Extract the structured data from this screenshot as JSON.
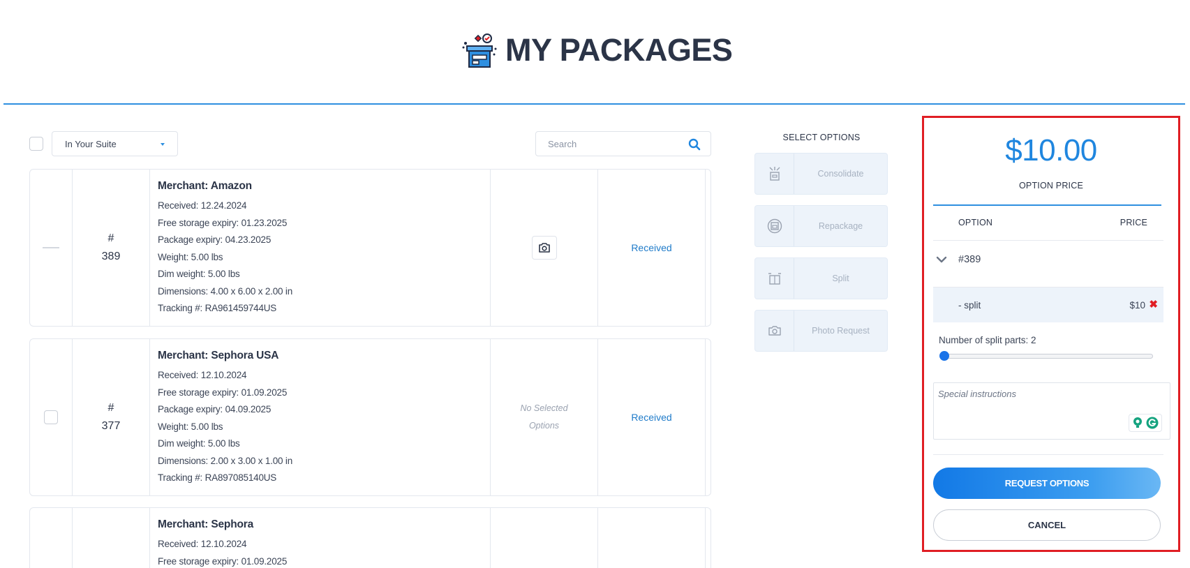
{
  "header": {
    "title": "MY PACKAGES",
    "logo_icon": "package-checklist-icon"
  },
  "toolbar": {
    "status_filter": "In Your Suite",
    "search_placeholder": "Search"
  },
  "packages": [
    {
      "number_prefix": "#",
      "number": "389",
      "merchant": "Merchant: Amazon",
      "details": [
        "Received: 12.24.2024",
        "Free storage expiry: 01.23.2025",
        "Package expiry: 04.23.2025",
        "Weight: 5.00 lbs",
        "Dim weight: 5.00 lbs",
        "Dimensions: 4.00 x 6.00 x 2.00 in",
        "Tracking #: RA961459744US"
      ],
      "options_label": "",
      "status": "Received",
      "selected": true
    },
    {
      "number_prefix": "#",
      "number": "377",
      "merchant": "Merchant: Sephora USA",
      "details": [
        "Received: 12.10.2024",
        "Free storage expiry: 01.09.2025",
        "Package expiry: 04.09.2025",
        "Weight: 5.00 lbs",
        "Dim weight: 5.00 lbs",
        "Dimensions: 2.00 x 3.00 x 1.00 in",
        "Tracking #: RA897085140US"
      ],
      "options_label": "No Selected Options",
      "options_line1": "No Selected",
      "options_line2": "Options",
      "status": "Received",
      "selected": false
    },
    {
      "number_prefix": "",
      "number": "",
      "merchant": "Merchant: Sephora",
      "details": [
        "Received: 12.10.2024",
        "Free storage expiry: 01.09.2025"
      ],
      "status": "",
      "selected": false
    }
  ],
  "select_options": {
    "title": "SELECT OPTIONS",
    "items": [
      {
        "label": "Consolidate",
        "icon": "consolidate-icon"
      },
      {
        "label": "Repackage",
        "icon": "repackage-icon"
      },
      {
        "label": "Split",
        "icon": "split-icon"
      },
      {
        "label": "Photo Request",
        "icon": "camera-icon"
      }
    ]
  },
  "summary": {
    "price": "$10.00",
    "price_label": "OPTION PRICE",
    "col_option": "OPTION",
    "col_price": "PRICE",
    "package_label": "#389",
    "option_name": "- split",
    "option_price": "$10",
    "remove_symbol": "✖",
    "split_parts_label": "Number of split parts: 2",
    "split_parts": 2,
    "instructions_placeholder": "Special instructions",
    "request_label": "REQUEST OPTIONS",
    "cancel_label": "CANCEL"
  },
  "colors": {
    "accent": "#1f86df",
    "remove": "#e01e24",
    "highlight_border": "#e01e24",
    "status": "#1f7bc9"
  }
}
